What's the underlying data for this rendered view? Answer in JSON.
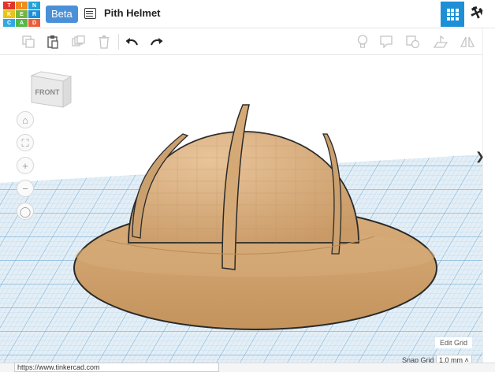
{
  "app": {
    "logo_letters": [
      "TIN",
      "KER",
      "CAD"
    ],
    "beta_label": "Beta",
    "design_title": "Pith Helmet",
    "brand_colors": [
      "#e1352a",
      "#f18b1f",
      "#23a1d7",
      "#e9c31d",
      "#77b443",
      "#1d8fd6",
      "#33a8e0",
      "#52b848",
      "#ec5c3a"
    ],
    "accent": "#1d8fd6"
  },
  "header": {
    "list_icon": "list-icon",
    "grid_view_icon": "grid-view-icon",
    "build_icon": "hammer-icon"
  },
  "toolbar": {
    "left": [
      "copy-icon",
      "paste-icon",
      "duplicate-icon",
      "delete-icon",
      "undo-icon",
      "redo-icon"
    ],
    "right": [
      "lightbulb-icon",
      "note-icon",
      "shape-note-icon",
      "workplane-icon",
      "mirror-icon"
    ]
  },
  "viewcube": {
    "face_label": "FRONT"
  },
  "nav": [
    "home-icon",
    "fit-icon",
    "zoom-in-icon",
    "zoom-out-icon",
    "perspective-icon"
  ],
  "grid": {
    "edit_label": "Edit Grid",
    "snap_label": "Snap Grid",
    "snap_value": "1.0 mm ˄"
  },
  "model": {
    "color": "#d4a574",
    "edge_color": "#2a2a2a"
  },
  "status": {
    "url": "https://www.tinkercad.com"
  }
}
